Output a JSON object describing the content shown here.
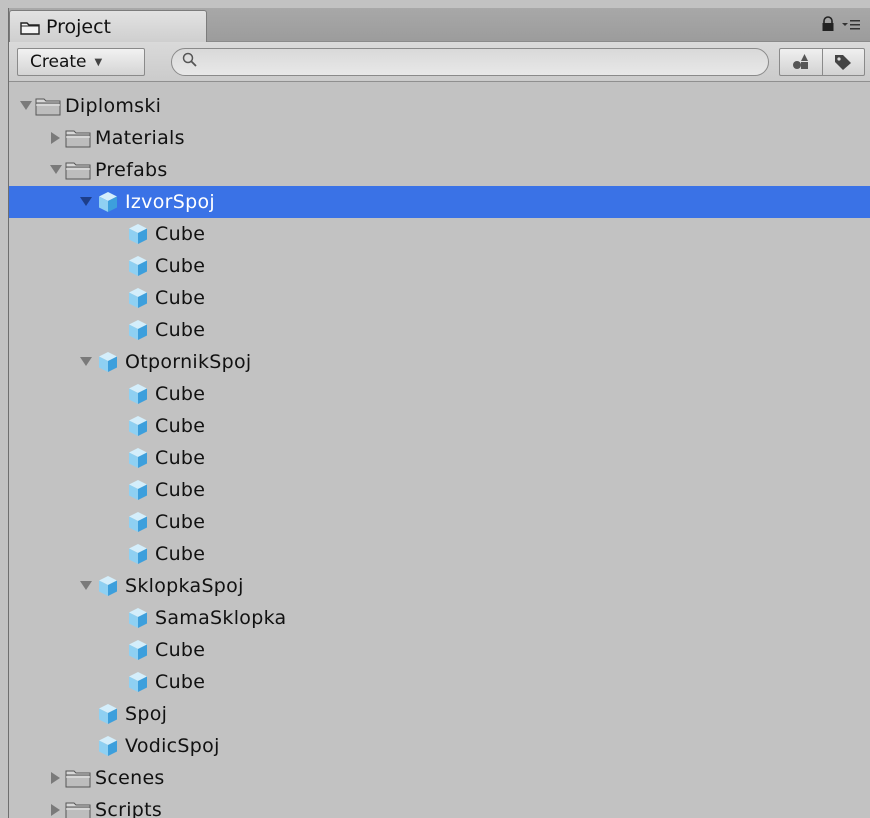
{
  "tab": {
    "label": "Project",
    "icon": "folder-icon"
  },
  "toolbar": {
    "create_label": "Create",
    "search_placeholder": "",
    "search_value": "",
    "icons": [
      "search-icon",
      "filter-by-type-icon",
      "filter-by-label-icon"
    ]
  },
  "tree": [
    {
      "label": "Diplomski",
      "depth": 0,
      "icon": "folder",
      "arrow": "expanded"
    },
    {
      "label": "Materials",
      "depth": 1,
      "icon": "folder",
      "arrow": "collapsed"
    },
    {
      "label": "Prefabs",
      "depth": 1,
      "icon": "folder",
      "arrow": "expanded"
    },
    {
      "label": "IzvorSpoj",
      "depth": 2,
      "icon": "cube",
      "arrow": "expanded",
      "selected": true
    },
    {
      "label": "Cube",
      "depth": 3,
      "icon": "cube",
      "arrow": "none"
    },
    {
      "label": "Cube",
      "depth": 3,
      "icon": "cube",
      "arrow": "none"
    },
    {
      "label": "Cube",
      "depth": 3,
      "icon": "cube",
      "arrow": "none"
    },
    {
      "label": "Cube",
      "depth": 3,
      "icon": "cube",
      "arrow": "none"
    },
    {
      "label": "OtpornikSpoj",
      "depth": 2,
      "icon": "cube",
      "arrow": "expanded"
    },
    {
      "label": "Cube",
      "depth": 3,
      "icon": "cube",
      "arrow": "none"
    },
    {
      "label": "Cube",
      "depth": 3,
      "icon": "cube",
      "arrow": "none"
    },
    {
      "label": "Cube",
      "depth": 3,
      "icon": "cube",
      "arrow": "none"
    },
    {
      "label": "Cube",
      "depth": 3,
      "icon": "cube",
      "arrow": "none"
    },
    {
      "label": "Cube",
      "depth": 3,
      "icon": "cube",
      "arrow": "none"
    },
    {
      "label": "Cube",
      "depth": 3,
      "icon": "cube",
      "arrow": "none"
    },
    {
      "label": "SklopkaSpoj",
      "depth": 2,
      "icon": "cube",
      "arrow": "expanded"
    },
    {
      "label": "SamaSklopka",
      "depth": 3,
      "icon": "cube",
      "arrow": "none"
    },
    {
      "label": "Cube",
      "depth": 3,
      "icon": "cube",
      "arrow": "none"
    },
    {
      "label": "Cube",
      "depth": 3,
      "icon": "cube",
      "arrow": "none"
    },
    {
      "label": "Spoj",
      "depth": 2,
      "icon": "cube",
      "arrow": "none"
    },
    {
      "label": "VodicSpoj",
      "depth": 2,
      "icon": "cube",
      "arrow": "none"
    },
    {
      "label": "Scenes",
      "depth": 1,
      "icon": "folder",
      "arrow": "collapsed"
    },
    {
      "label": "Scripts",
      "depth": 1,
      "icon": "folder",
      "arrow": "collapsed"
    }
  ],
  "colors": {
    "selection": "#3a72e6",
    "panel": "#c2c2c2",
    "cube_light": "#8fd0f2",
    "cube_dark": "#3d9fdc"
  }
}
